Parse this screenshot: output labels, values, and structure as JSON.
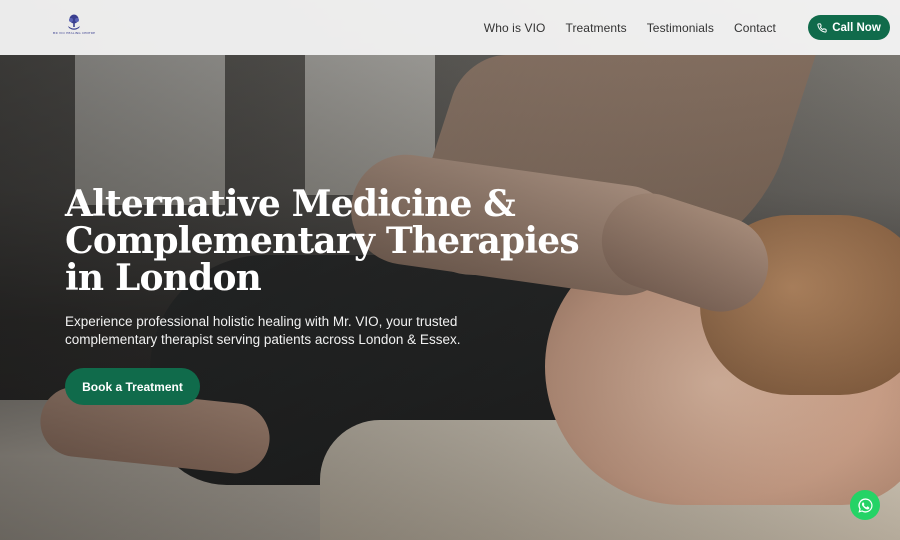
{
  "header": {
    "logo_text": "MR VIO HEALING CENTRE",
    "nav": [
      {
        "label": "Who is VIO"
      },
      {
        "label": "Treatments"
      },
      {
        "label": "Testimonials"
      },
      {
        "label": "Contact"
      }
    ],
    "call_label": "Call Now"
  },
  "hero": {
    "headline_lines": [
      "Alternative Medicine &",
      "Complementary Therapies",
      "in London"
    ],
    "subtext_lines": [
      "Experience professional holistic healing with Mr. VIO, your trusted",
      "complementary therapist serving patients across London & Essex."
    ],
    "cta_label": "Book a Treatment"
  },
  "icons": {
    "logo": "tree-hand-logo-icon",
    "call": "phone-icon",
    "whatsapp": "whatsapp-icon"
  },
  "colors": {
    "brand_green": "#106b4b",
    "whatsapp_green": "#25d366",
    "logo_navy": "#3a3f8f"
  }
}
